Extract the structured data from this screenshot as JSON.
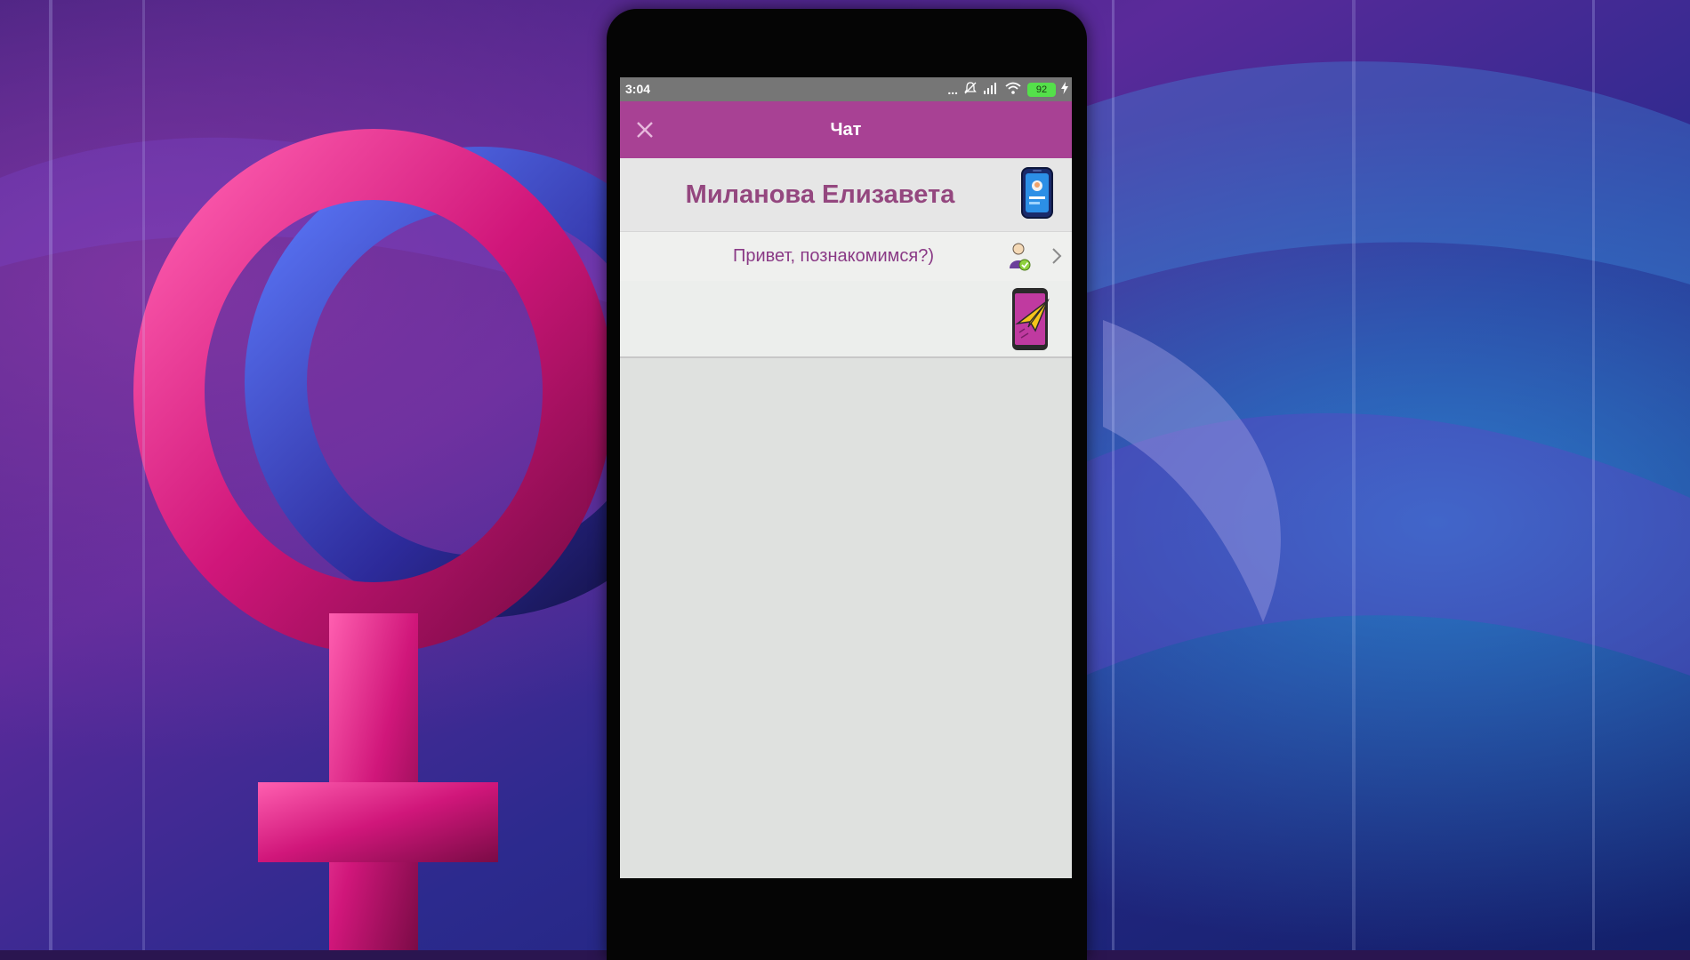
{
  "status_bar": {
    "time": "3:04",
    "dots": "...",
    "battery": "92",
    "icons": [
      "mute-bell-icon",
      "signal-icon",
      "wifi-icon",
      "battery-icon",
      "charging-icon"
    ]
  },
  "app_bar": {
    "title": "Чат",
    "close_icon": "close-icon",
    "background_color": "#a84194"
  },
  "contact": {
    "name": "Миланова Елизавета",
    "name_color": "#94477f",
    "profile_icon": "phone-profile-icon"
  },
  "messages": [
    {
      "text": "Привет, познакомимся?)",
      "sender_icon": "user-check-icon",
      "arrow_icon": "chevron-right-icon"
    }
  ],
  "compose": {
    "send_icon": "paper-plane-phone-icon"
  }
}
